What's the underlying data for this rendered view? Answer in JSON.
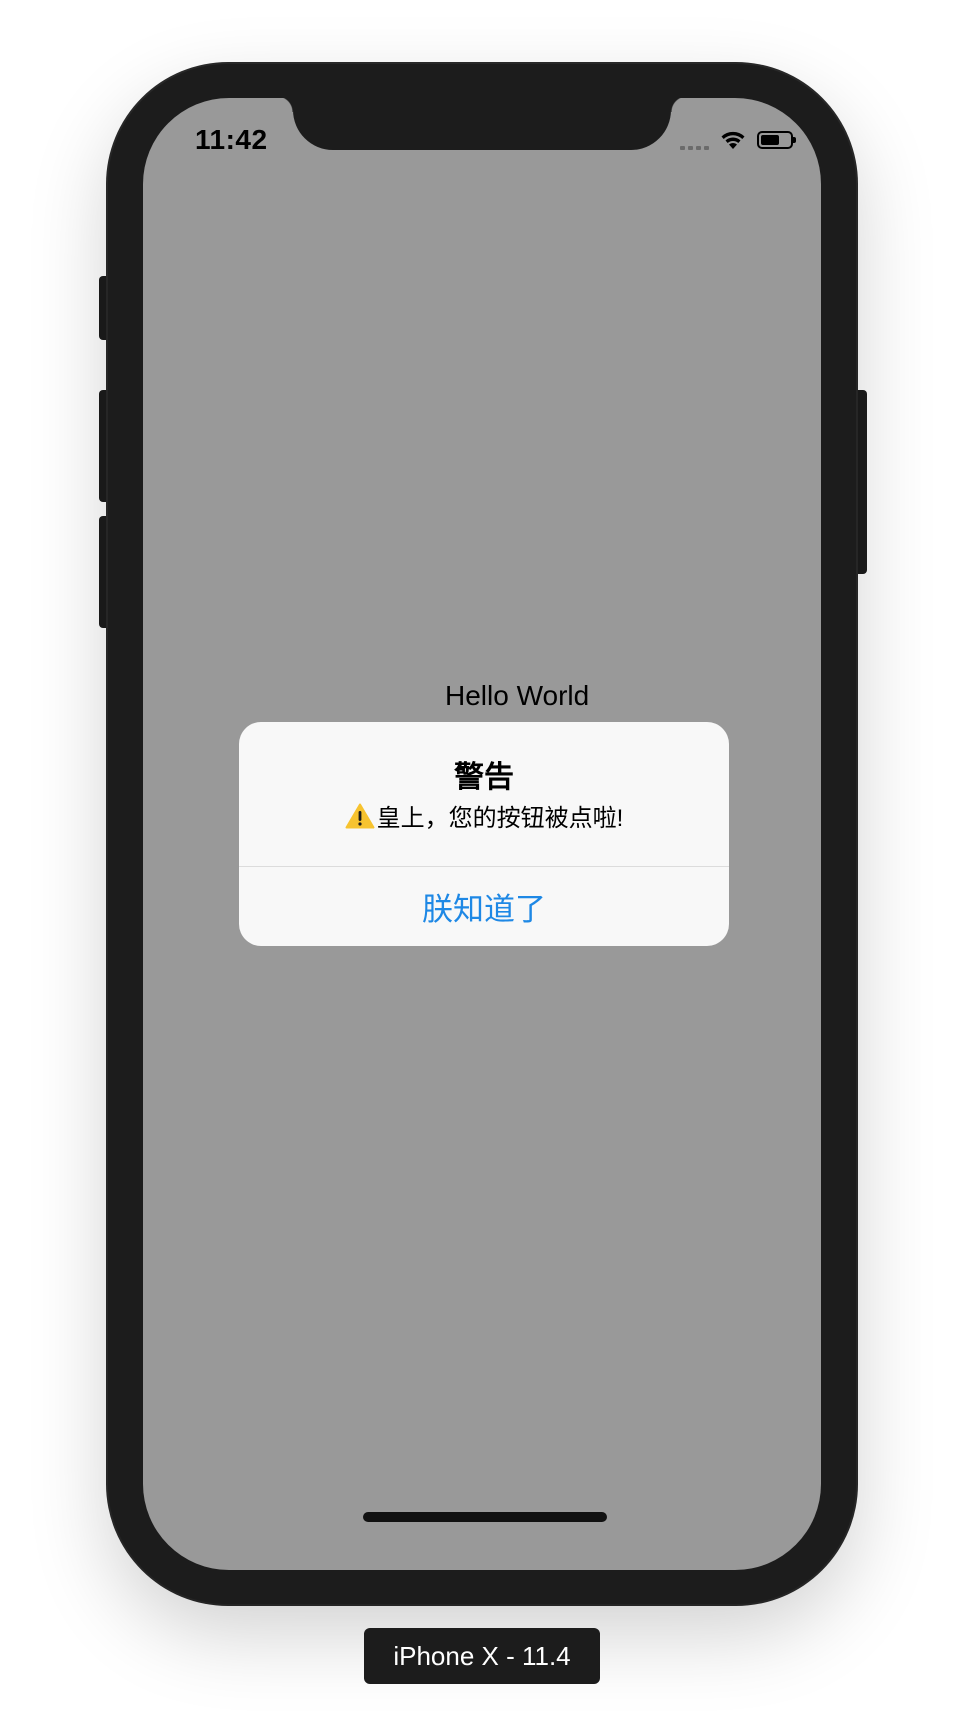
{
  "simulator": {
    "device_label": "iPhone X - 11.4"
  },
  "status_bar": {
    "time": "11:42",
    "wifi_icon": "wifi-icon",
    "battery_icon": "battery-icon"
  },
  "screen": {
    "background": "#999999",
    "label_text": "Hello World"
  },
  "alert": {
    "title": "警告",
    "message_icon": "warning-icon",
    "message": "皇上，您的按钮被点啦!",
    "action_label": "朕知道了",
    "action_color": "#1e88e5"
  }
}
